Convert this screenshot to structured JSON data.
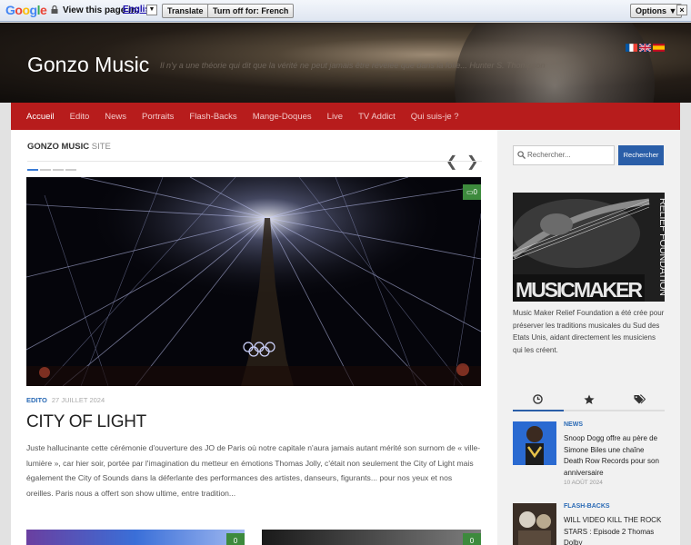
{
  "translate_bar": {
    "brand": "Google",
    "prompt": "View this page in:",
    "language": "English",
    "translate_button": "Translate",
    "turn_off_button": "Turn off for: French",
    "options_button": "Options ▼",
    "close": "×"
  },
  "header": {
    "site_title": "Gonzo Music",
    "tagline": "Il n'y a une théorie qui dit que la vérité ne peut jamais être révélée que dans la folie... Hunter S. Thompson"
  },
  "nav": {
    "items": [
      {
        "label": "Accueil",
        "active": true
      },
      {
        "label": "Edito"
      },
      {
        "label": "News"
      },
      {
        "label": "Portraits"
      },
      {
        "label": "Flash-Backs"
      },
      {
        "label": "Mange-Doques"
      },
      {
        "label": "Live"
      },
      {
        "label": "TV Addict"
      },
      {
        "label": "Qui suis-je ?"
      }
    ]
  },
  "featured": {
    "section_title": "GONZO MUSIC",
    "section_sub": "SITE",
    "comment_count": "0",
    "category": "EDITO",
    "date": "27 JUILLET 2024",
    "title": "CITY OF LIGHT",
    "excerpt": "Juste hallucinante cette cérémonie d'ouverture des JO de Paris où notre capitale n'aura jamais autant mérité son surnom de « ville-lumière », car hier soir, portée par l'imagination du metteur en émotions Thomas Jolly, c'était non seulement the City of Light mais également the City of Sounds dans la déferlante des performances des artistes, danseurs, figurants... pour nos yeux et nos oreilles. Paris nous a offert son show ultime, entre tradition...",
    "thumb1_comments": "0",
    "thumb2_comments": "0"
  },
  "sidebar": {
    "search_placeholder": "Rechercher...",
    "search_button": "Rechercher",
    "mm_logo_main": "MUSICMAKER",
    "mm_logo_side": "RELIEF FOUNDATION",
    "mm_desc": "Music Maker Relief Foundation a été crée pour préserver les traditions musicales du Sud des Etats Unis, aidant directement les musiciens qui les créent.",
    "posts": [
      {
        "category": "NEWS",
        "title": "Snoop Dogg offre au père de Simone Biles une chaîne Death Row Records pour son anniversaire",
        "date": "10 AOÛT 2024"
      },
      {
        "category": "FLASH-BACKS",
        "title": "WILL VIDEO KILL THE ROCK STARS : Episode 2 Thomas Dolby",
        "date": ""
      }
    ]
  },
  "colors": {
    "nav_red": "#b71c1c",
    "accent_blue": "#2a5ea8",
    "comment_green": "#3d8a3d"
  }
}
